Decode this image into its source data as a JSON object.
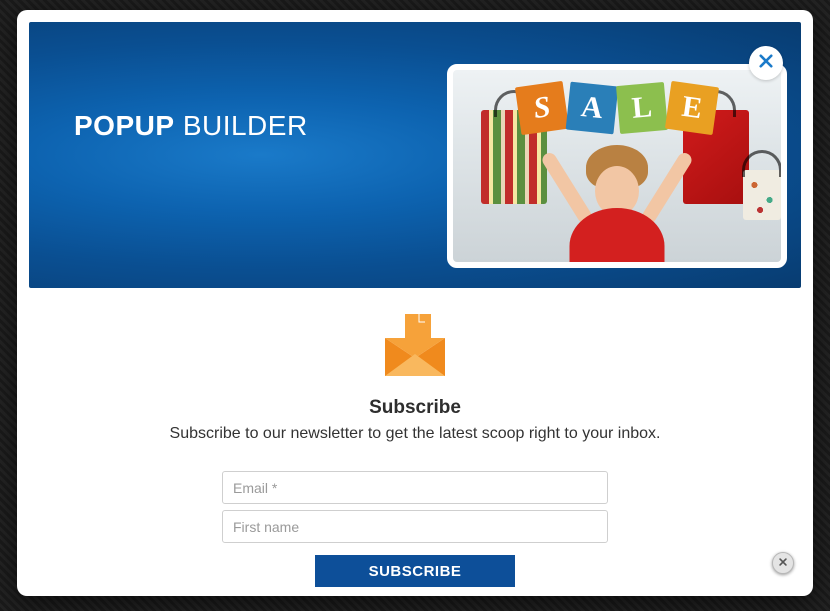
{
  "brand": {
    "bold": "POPUP",
    "light": "BUILDER"
  },
  "promo": {
    "letters": [
      "S",
      "A",
      "L",
      "E"
    ]
  },
  "subscribe": {
    "title": "Subscribe",
    "description": "Subscribe to our newsletter to get the latest scoop right to your inbox.",
    "email_placeholder": "Email *",
    "firstname_placeholder": "First name",
    "button": "SUBSCRIBE"
  }
}
